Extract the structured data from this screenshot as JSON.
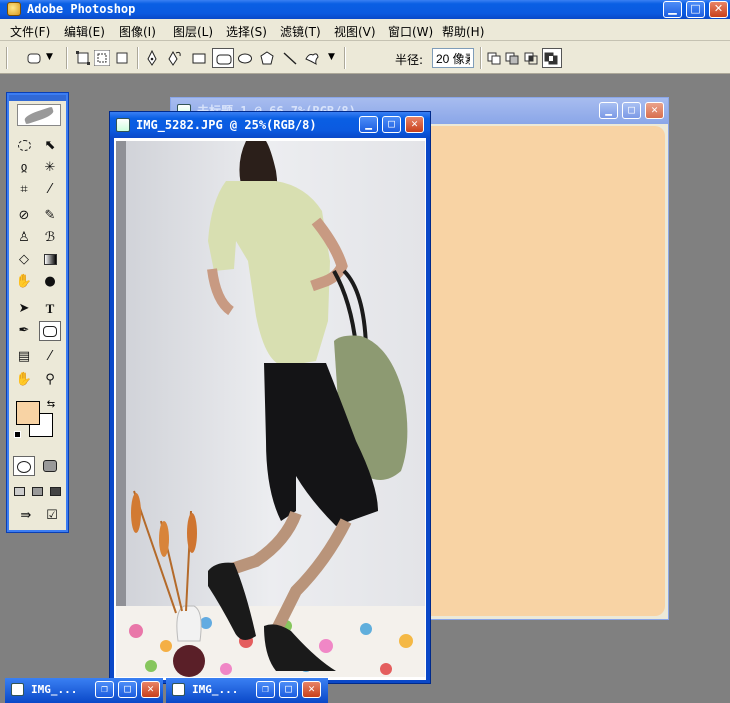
{
  "app": {
    "title": "Adobe Photoshop"
  },
  "menu": [
    {
      "label": "文件(F)"
    },
    {
      "label": "编辑(E)"
    },
    {
      "label": "图像(I)"
    },
    {
      "label": "图层(L)"
    },
    {
      "label": "选择(S)"
    },
    {
      "label": "滤镜(T)"
    },
    {
      "label": "视图(V)"
    },
    {
      "label": "窗口(W)"
    },
    {
      "label": "帮助(H)"
    }
  ],
  "options": {
    "radius_label": "半径:",
    "radius_value": "20 像素"
  },
  "colors": {
    "foreground": "#f8d3a4",
    "background": "#ffffff",
    "titlebar": "#0b5ae0",
    "canvas": "#f8d3a4"
  },
  "documents": {
    "back": {
      "title": "未标题-1 @ 66.7%(RGB/8)"
    },
    "front": {
      "title": "IMG_5282.JPG @ 25%(RGB/8)"
    },
    "minimized": [
      {
        "title": "IMG_..."
      },
      {
        "title": "IMG_..."
      }
    ]
  }
}
